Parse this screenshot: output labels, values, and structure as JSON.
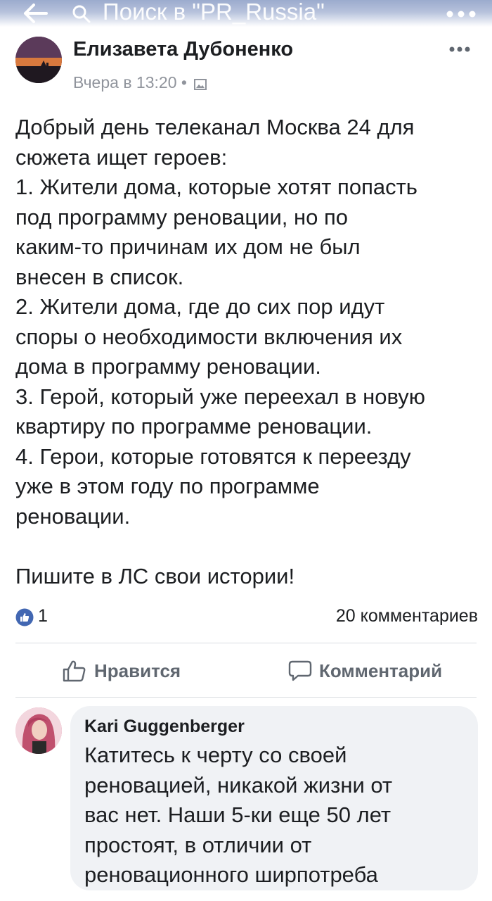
{
  "topbar": {
    "search_text": "Поиск в \"PR_Russia\""
  },
  "post": {
    "author": "Елизавета Дубоненко",
    "time": "Вчера в 13:20 •",
    "lines": [
      "Добрый день телеканал Москва 24 для",
      "сюжета ищет героев:",
      "1. Жители дома, которые хотят попасть",
      "под программу реновации, но по",
      "каким-то причинам их дом не был",
      "внесен в список.",
      "2. Жители дома, где до сих пор идут",
      "споры о необходимости включения их",
      "дома в программу реновации.",
      "3. Герой, который уже переехал  в новую",
      "квартиру по программе реновации.",
      "4. Герои, которые готовятся к переезду",
      "уже в этом году по программе",
      "реновации.",
      "",
      "Пишите в ЛС свои истории!"
    ],
    "like_count": "1",
    "comment_count": "20 комментариев"
  },
  "actions": {
    "like_label": "Нравится",
    "comment_label": "Комментарий"
  },
  "comment": {
    "author": "Kari Guggenberger",
    "lines": [
      "Катитесь к черту со своей",
      "реновацией, никакой жизни от",
      "вас нет. Наши 5-ки еще 50 лет",
      "простоят, в отличии от",
      "реновационного ширпотреба"
    ]
  },
  "colors": {
    "brand_blue": "#4267b2",
    "text": "#1c1e21",
    "secondary": "#606770",
    "bubble": "#f0f2f5"
  },
  "icons": [
    "back-arrow-icon",
    "search-icon",
    "more-icon",
    "photo-icon",
    "like-reaction-icon",
    "thumbs-up-icon",
    "comment-icon"
  ]
}
